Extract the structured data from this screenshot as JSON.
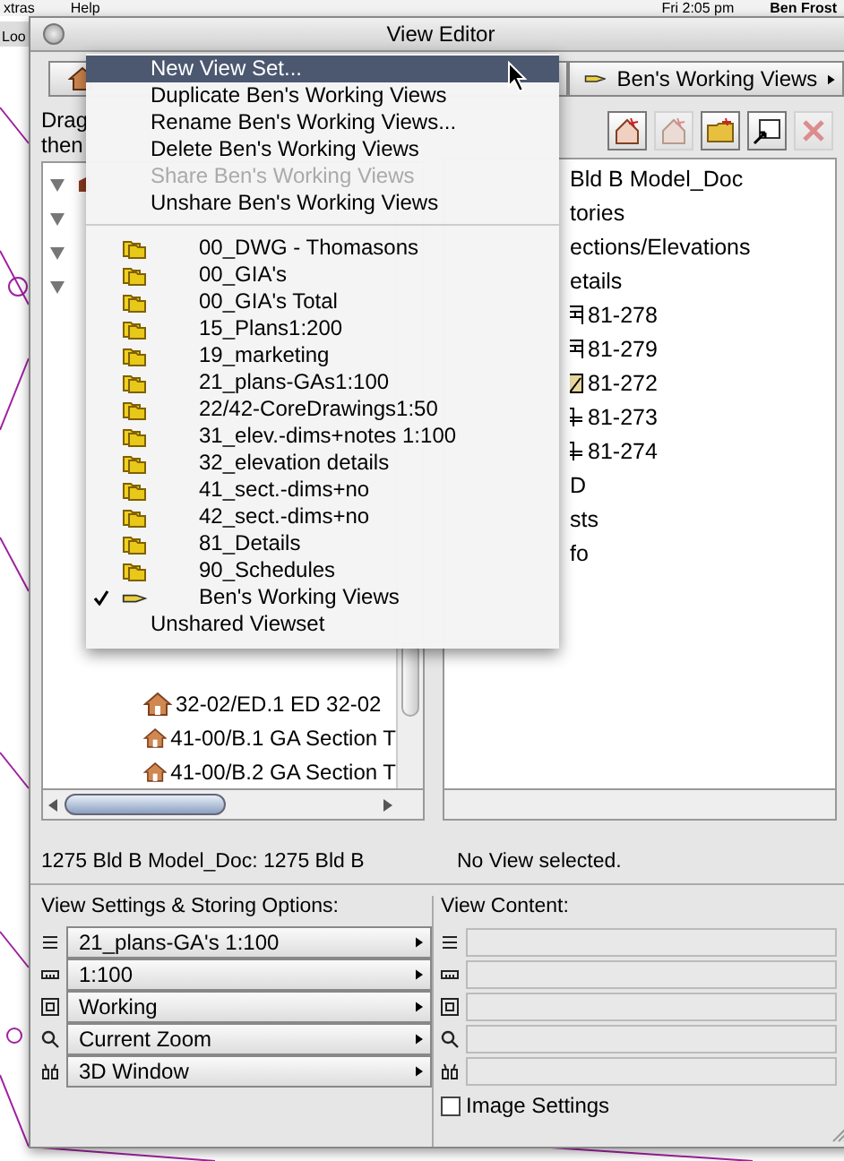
{
  "menubar": {
    "items": [
      "xtras",
      "Help"
    ],
    "clock": "Fri 2:05 pm",
    "user": "Ben Frost"
  },
  "background_window": {
    "title_fragment": "Loo"
  },
  "window": {
    "title": "View Editor"
  },
  "view_set_popup": {
    "label": "Ben's Working Views"
  },
  "hint_lines": [
    "Drag",
    "then"
  ],
  "left_tree": {
    "rows": [
      {
        "kind": "model-group",
        "expanded": true
      },
      {
        "kind": "group",
        "expanded": true
      },
      {
        "kind": "group",
        "expanded": true
      },
      {
        "kind": "group",
        "expanded": true
      },
      {
        "kind": "view",
        "label": "32-02/ED.1 ED 32-02"
      },
      {
        "kind": "view",
        "label": "41-00/B.1 GA Section T"
      },
      {
        "kind": "view",
        "label": "41-00/B.2 GA Section T"
      }
    ]
  },
  "toolbar": {
    "buttons": [
      {
        "kind": "new-view",
        "disabled": false
      },
      {
        "kind": "clone",
        "disabled": true
      },
      {
        "kind": "new-folder",
        "disabled": false
      },
      {
        "kind": "redefine",
        "disabled": false
      },
      {
        "kind": "delete",
        "disabled": true
      }
    ]
  },
  "right_tree": {
    "rows": [
      {
        "kind": "text",
        "label": "Bld B Model_Doc"
      },
      {
        "kind": "text",
        "label": "tories"
      },
      {
        "kind": "text",
        "label": "ections/Elevations"
      },
      {
        "kind": "text",
        "label": "etails"
      },
      {
        "kind": "detail",
        "label": "81-278"
      },
      {
        "kind": "detail",
        "label": "81-279"
      },
      {
        "kind": "drawing",
        "label": "81-272"
      },
      {
        "kind": "section",
        "label": "81-273"
      },
      {
        "kind": "section",
        "label": "81-274"
      },
      {
        "kind": "text",
        "label": "D"
      },
      {
        "kind": "text",
        "label": "sts"
      },
      {
        "kind": "text",
        "label": "fo"
      }
    ]
  },
  "status": {
    "left": "1275 Bld B Model_Doc: 1275 Bld B",
    "right": "No View selected."
  },
  "view_settings": {
    "title": "View Settings & Storing Options:",
    "options": [
      {
        "kind": "layers",
        "value": "21_plans-GA's 1:100"
      },
      {
        "kind": "scale",
        "value": "1:100"
      },
      {
        "kind": "frame",
        "value": "Working"
      },
      {
        "kind": "zoom",
        "value": "Current Zoom"
      },
      {
        "kind": "window3d",
        "value": "3D Window"
      }
    ]
  },
  "view_content": {
    "title": "View Content:",
    "fields": [
      {
        "kind": "layers"
      },
      {
        "kind": "scale"
      },
      {
        "kind": "frame"
      },
      {
        "kind": "zoom"
      },
      {
        "kind": "window3d"
      }
    ],
    "image_settings": {
      "label": "Image Settings",
      "checked": false
    }
  },
  "menu": {
    "commands": [
      {
        "label": "New View Set...",
        "selected": true,
        "disabled": false
      },
      {
        "label": "Duplicate Ben's Working Views",
        "selected": false,
        "disabled": false
      },
      {
        "label": "Rename Ben's Working Views...",
        "selected": false,
        "disabled": false
      },
      {
        "label": "Delete Ben's Working Views",
        "selected": false,
        "disabled": false
      },
      {
        "label": "Share Ben's Working Views",
        "selected": false,
        "disabled": true
      },
      {
        "label": "Unshare Ben's Working Views",
        "selected": false,
        "disabled": false
      }
    ],
    "view_sets": [
      {
        "label": "00_DWG - Thomasons",
        "kind": "folder",
        "checked": false
      },
      {
        "label": "00_GIA's",
        "kind": "folder",
        "checked": false
      },
      {
        "label": "00_GIA's Total",
        "kind": "folder",
        "checked": false
      },
      {
        "label": "15_Plans1:200",
        "kind": "folder",
        "checked": false
      },
      {
        "label": "19_marketing",
        "kind": "folder",
        "checked": false
      },
      {
        "label": "21_plans-GAs1:100",
        "kind": "folder",
        "checked": false
      },
      {
        "label": "22/42-CoreDrawings1:50",
        "kind": "folder",
        "checked": false
      },
      {
        "label": "31_elev.-dims+notes 1:100",
        "kind": "folder",
        "checked": false
      },
      {
        "label": "32_elevation details",
        "kind": "folder",
        "checked": false
      },
      {
        "label": "41_sect.-dims+no",
        "kind": "folder",
        "checked": false
      },
      {
        "label": "42_sect.-dims+no",
        "kind": "folder",
        "checked": false
      },
      {
        "label": "81_Details",
        "kind": "folder",
        "checked": false
      },
      {
        "label": "90_Schedules",
        "kind": "folder",
        "checked": false
      },
      {
        "label": "Ben's Working Views",
        "kind": "hand",
        "checked": true
      }
    ],
    "footer": "Unshared Viewset"
  }
}
